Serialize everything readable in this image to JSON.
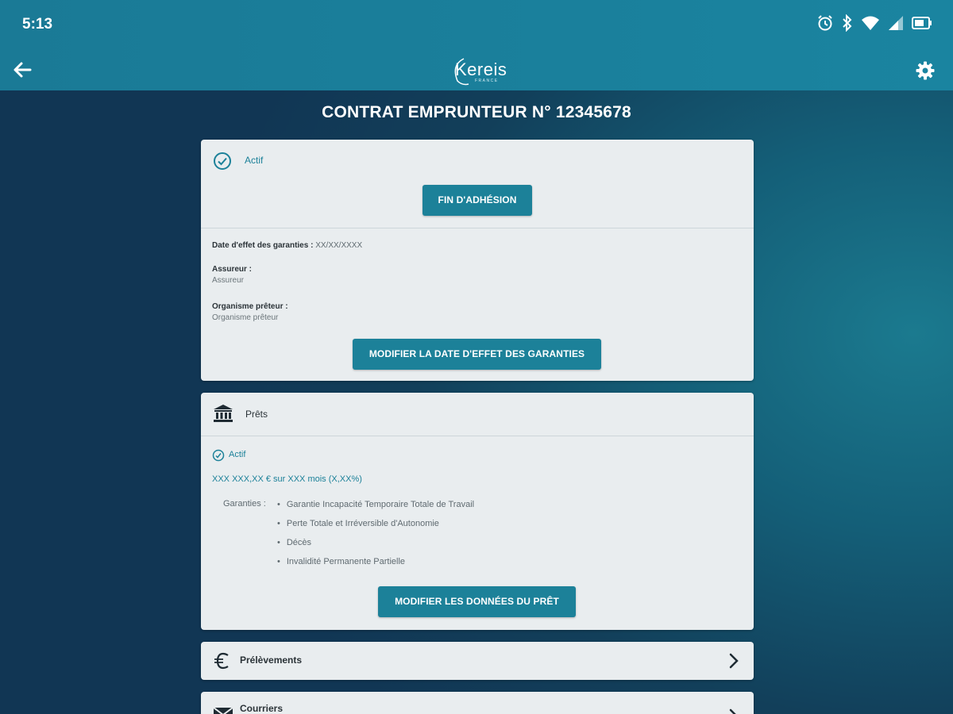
{
  "status_bar": {
    "time": "5:13"
  },
  "app_bar": {
    "logo_text": "Kereis",
    "logo_sub": "FRANCE"
  },
  "page": {
    "title": "CONTRAT EMPRUNTEUR N° 12345678"
  },
  "contract_card": {
    "status": "Actif",
    "end_button": "FIN D'ADHÉSION",
    "effective_date_label": "Date d'effet des garanties :",
    "effective_date_value": "XX/XX/XXXX",
    "insurer_label": "Assureur :",
    "insurer_value": "Assureur",
    "lender_label": "Organisme prêteur :",
    "lender_value": "Organisme prêteur",
    "modify_date_button": "MODIFIER LA DATE D'EFFET DES GARANTIES"
  },
  "loans_card": {
    "title": "Prêts",
    "status": "Actif",
    "loan_summary": "XXX XXX,XX € sur XXX mois (X,XX%)",
    "garanties_label": "Garanties :",
    "garanties": [
      "Garantie Incapacité Temporaire Totale de Travail",
      "Perte Totale et Irréversible d'Autonomie",
      "Décès",
      "Invalidité Permanente Partielle"
    ],
    "modify_button": "MODIFIER LES DONNÉES DU PRÊT"
  },
  "rows": [
    {
      "label": "Prélèvements",
      "icon": "euro-icon"
    },
    {
      "label": "Courriers",
      "icon": "mail-icon"
    }
  ],
  "colors": {
    "accent": "#1c8199",
    "header": "#1a84a0",
    "background": "#123f5a",
    "card": "#e9edef"
  }
}
